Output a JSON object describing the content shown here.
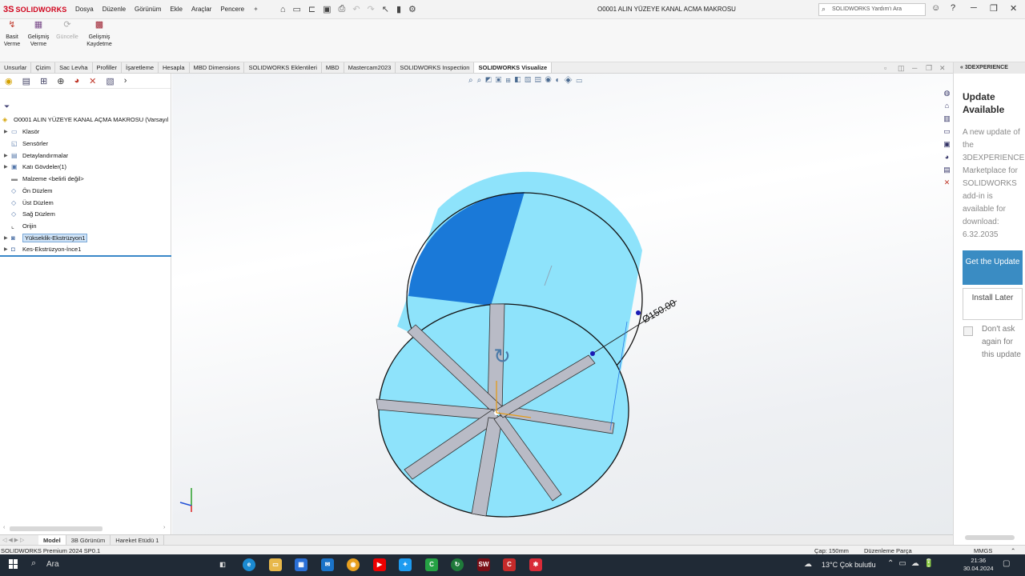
{
  "app": {
    "logo_ds": "3S",
    "logo_name": "SOLIDWORKS",
    "doc_title": "O0001 ALIN YÜZEYE KANAL ACMA MAKROSU"
  },
  "menu": [
    "Dosya",
    "Düzenle",
    "Görünüm",
    "Ekle",
    "Araçlar",
    "Pencere"
  ],
  "help_search_placeholder": "SOLIDWORKS Yardım'ı Ara",
  "commands": [
    {
      "label": "Basit Verme",
      "icon": "arrow-down-icon"
    },
    {
      "label": "Gelişmiş Verme",
      "icon": "render-icon"
    },
    {
      "label": "Güncelle",
      "icon": "refresh-icon",
      "disabled": true
    },
    {
      "label": "Gelişmiş Kaydetme",
      "icon": "save-icon"
    }
  ],
  "tabs": [
    "Unsurlar",
    "Çizim",
    "Sac Levha",
    "Profiller",
    "İşaretleme",
    "Hesapla",
    "MBD Dimensions",
    "SOLIDWORKS Eklentileri",
    "MBD",
    "Mastercam2023",
    "SOLIDWORKS Inspection",
    "SOLIDWORKS Visualize"
  ],
  "active_tab": 11,
  "tree": {
    "root": "O0001 ALIN YÜZEYE KANAL AÇMA MAKROSU (Varsayıl",
    "items": [
      {
        "label": "Klasör",
        "expandable": true
      },
      {
        "label": "Sensörler",
        "expandable": false
      },
      {
        "label": "Detaylandırmalar",
        "expandable": true
      },
      {
        "label": "Katı Gövdeler(1)",
        "expandable": true
      },
      {
        "label": "Malzeme <belirli değil>",
        "expandable": false
      },
      {
        "label": "Ön Düzlem",
        "expandable": false
      },
      {
        "label": "Üst Düzlem",
        "expandable": false
      },
      {
        "label": "Sağ Düzlem",
        "expandable": false
      },
      {
        "label": "Orijin",
        "expandable": false
      },
      {
        "label": "Yükseklik-Ekstrüzyon1",
        "expandable": true,
        "selected": true
      },
      {
        "label": "Kes-Ekstrüzyon-İnce1",
        "expandable": true
      }
    ]
  },
  "viewport": {
    "dimension": "Ø150.00",
    "colors": {
      "body_light": "#8ee3fb",
      "body_dark": "#1a79d8",
      "slot": "#b9bbc6"
    }
  },
  "update_panel": {
    "header": "3DEXPERIENCE",
    "title": "Update Available",
    "body": "A new update of the 3DEXPERIENCE Marketplace for SOLIDWORKS add-in is available for download: 6.32.2035",
    "primary_button": "Get the Update",
    "secondary_button": "Install Later",
    "checkbox_label": "Don't ask again for this update"
  },
  "bottom_tabs": [
    "Model",
    "3B Görünüm",
    "Hareket Etüdü 1"
  ],
  "status": {
    "product": "SOLIDWORKS Premium 2024 SP0.1",
    "diameter": "Çap: 150mm",
    "mode": "Düzenleme Parça",
    "units": "MMGS"
  },
  "taskbar": {
    "search": "Ara",
    "weather": "13°C  Çok bulutlu",
    "time": "21:36",
    "date": "30.04.2024"
  }
}
